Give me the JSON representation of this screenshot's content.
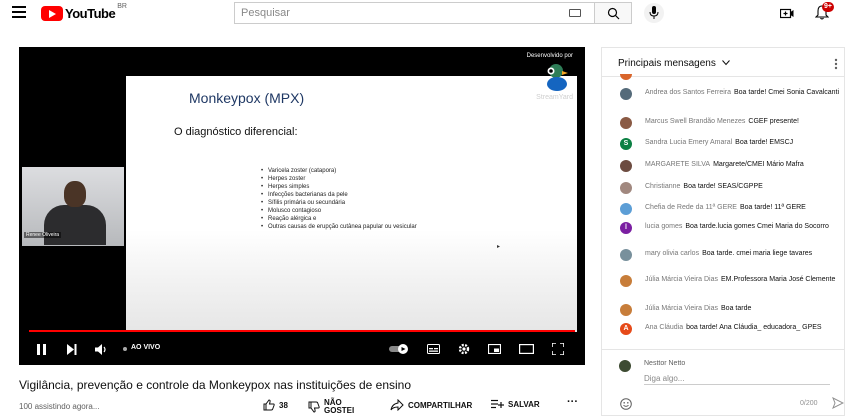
{
  "header": {
    "logo_text": "YouTube",
    "country": "BR",
    "search_placeholder": "Pesquisar",
    "notifications": "9+"
  },
  "player": {
    "slide": {
      "title": "Monkeypox (MPX)",
      "subtitle": "O diagnóstico diferencial:",
      "items": [
        "Varicela zoster (catapora)",
        "Herpes zoster",
        "Herpes simples",
        "Infecções bacterianas da pele",
        "Sífilis primária ou secundária",
        "Molusco contagioso",
        "Reação alérgica e",
        "Outras causas de erupção cutânea papular ou vesicular"
      ]
    },
    "webcam_label": "Renee Oliveira",
    "branding_caption": "Desenvolvido por",
    "branding_name": "StreamYard",
    "live_label": "AO VIVO",
    "progress": 1.0
  },
  "video": {
    "title": "Vigilância, prevenção e controle da Monkeypox nas instituições de ensino",
    "viewers": "100 assistindo agora...",
    "likes": "38",
    "dislike_label_1": "NÃO",
    "dislike_label_2": "GOSTEI",
    "share_label": "COMPARTILHAR",
    "save_label": "SALVAR"
  },
  "chat": {
    "header": "Principais mensagens",
    "messages": [
      {
        "author": "Andrea dos Santos Ferreira",
        "text": "Boa tarde! Cmei Sonia Cavalcanti",
        "avatar_color": "#556b7a",
        "initial": ""
      },
      {
        "author": "Marcus Swell Brandão Menezes",
        "text": "CGEF presente!",
        "avatar_color": "#8a5a44",
        "initial": ""
      },
      {
        "author": "Sandra Lucia Emery Amaral",
        "text": "Boa tarde! EMSCJ",
        "avatar_color": "#0b8043",
        "initial": "S"
      },
      {
        "author": "MARGARETE SILVA",
        "text": "Margarete/CMEI Mário Mafra",
        "avatar_color": "#6d4c41",
        "initial": ""
      },
      {
        "author": "Christianne",
        "text": "Boa tarde! SEAS/CGPPE",
        "avatar_color": "#a1887f",
        "initial": ""
      },
      {
        "author": "Chefia de Rede da 11ª GERE",
        "text": "Boa tarde! 11ª GERE",
        "avatar_color": "#5c9ed6",
        "initial": ""
      },
      {
        "author": "lucia gomes",
        "text": "Boa tarde.lucia gomes Cmei Maria do Socorro",
        "avatar_color": "#7b1fa2",
        "initial": "l"
      },
      {
        "author": "mary olivia carlos",
        "text": "Boa tarde. cmei maria liege tavares",
        "avatar_color": "#78909c",
        "initial": ""
      },
      {
        "author": "Júlia Márcia Vieira Dias",
        "text": "EM.Professora Maria José Clemente",
        "avatar_color": "#c77d3a",
        "initial": ""
      },
      {
        "author": "Júlia Márcia Vieira Dias",
        "text": "Boa tarde",
        "avatar_color": "#c77d3a",
        "initial": ""
      },
      {
        "author": "Ana Cláudia",
        "text": "boa tarde! Ana Cláudia_ educadora_ GPES",
        "avatar_color": "#e64a19",
        "initial": "A"
      }
    ],
    "me": "Nesttor Netto",
    "input_placeholder": "Diga algo...",
    "char_count": "0/200"
  }
}
